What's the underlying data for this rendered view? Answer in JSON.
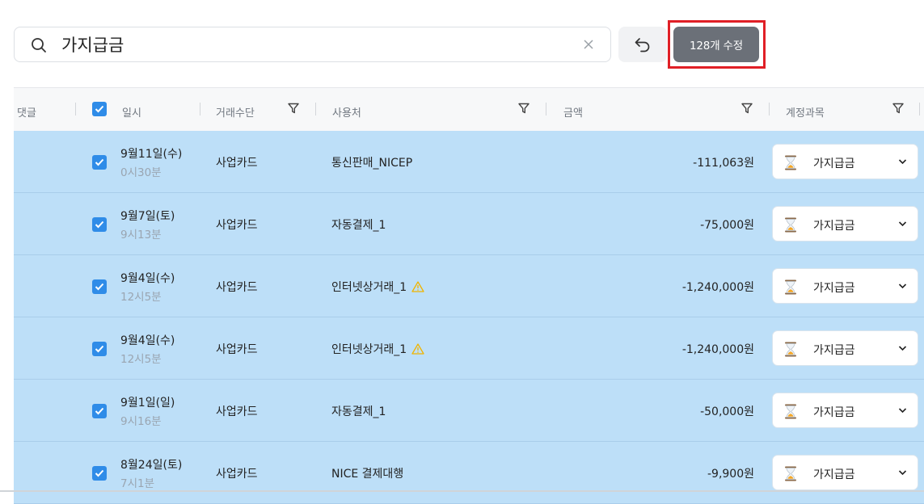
{
  "search": {
    "value": "가지급금"
  },
  "toolbar": {
    "edit_label": "128개 수정"
  },
  "columns": {
    "comment": "댓글",
    "datetime": "일시",
    "method": "거래수단",
    "vendor": "사용처",
    "amount": "금액",
    "account": "계정과목"
  },
  "rows": [
    {
      "date": "9월11일(수)",
      "time": "0시30분",
      "method": "사업카드",
      "vendor": "통신판매_NICEP",
      "warning": false,
      "amount": "-111,063원",
      "account": "가지급금",
      "checked": true
    },
    {
      "date": "9월7일(토)",
      "time": "9시13분",
      "method": "사업카드",
      "vendor": "자동결제_1",
      "warning": false,
      "amount": "-75,000원",
      "account": "가지급금",
      "checked": true
    },
    {
      "date": "9월4일(수)",
      "time": "12시5분",
      "method": "사업카드",
      "vendor": "인터넷상거래_1",
      "warning": true,
      "amount": "-1,240,000원",
      "account": "가지급금",
      "checked": true
    },
    {
      "date": "9월4일(수)",
      "time": "12시5분",
      "method": "사업카드",
      "vendor": "인터넷상거래_1",
      "warning": true,
      "amount": "-1,240,000원",
      "account": "가지급금",
      "checked": true
    },
    {
      "date": "9월1일(일)",
      "time": "9시16분",
      "method": "사업카드",
      "vendor": "자동결제_1",
      "warning": false,
      "amount": "-50,000원",
      "account": "가지급금",
      "checked": true
    },
    {
      "date": "8월24일(토)",
      "time": "7시1분",
      "method": "사업카드",
      "vendor": "NICE 결제대행",
      "warning": false,
      "amount": "-9,900원",
      "account": "가지급금",
      "checked": true
    }
  ],
  "colors": {
    "selected_row": "#bddff8",
    "checkbox": "#2f8ce8",
    "edit_button": "#6b7078",
    "highlight": "#e01f26"
  }
}
